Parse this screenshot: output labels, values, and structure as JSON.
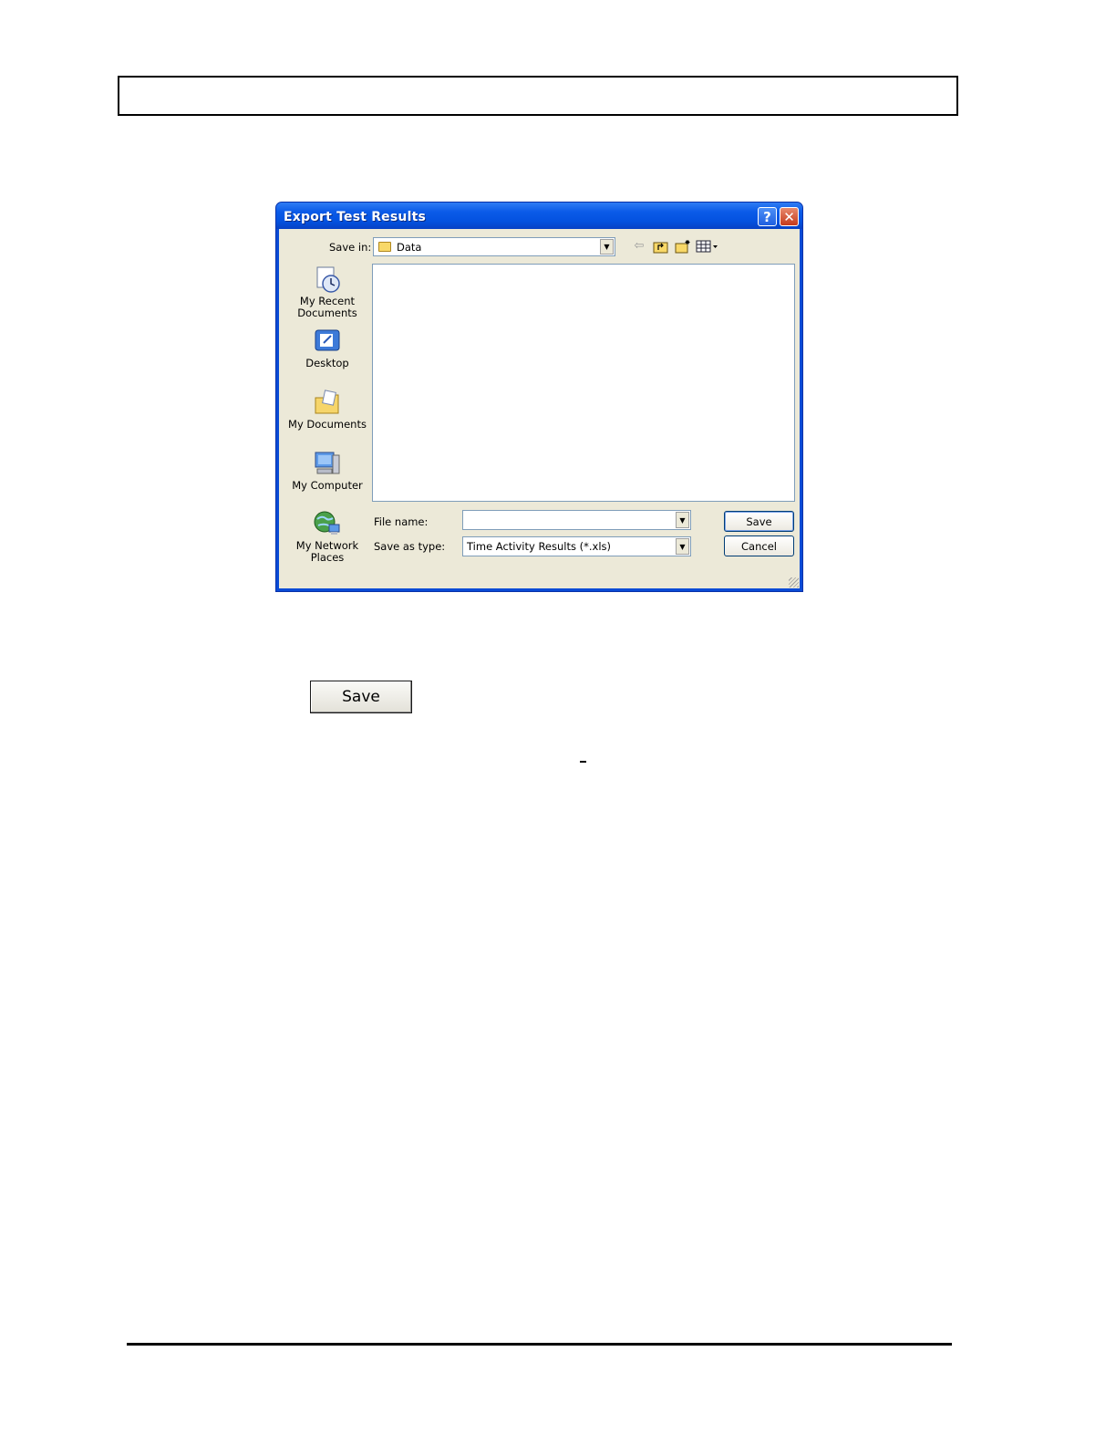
{
  "dialog": {
    "title": "Export Test  Results",
    "help_glyph": "?",
    "close_glyph": "✕",
    "save_in_label": "Save in:",
    "save_in_value": "Data",
    "places": [
      {
        "label": "My Recent Documents",
        "icon": "recent-documents-icon"
      },
      {
        "label": "Desktop",
        "icon": "desktop-icon"
      },
      {
        "label": "My Documents",
        "icon": "my-documents-icon"
      },
      {
        "label": "My Computer",
        "icon": "my-computer-icon"
      },
      {
        "label": "My Network Places",
        "icon": "network-places-icon"
      }
    ],
    "file_name_label": "File name:",
    "file_name_value": "",
    "save_as_type_label": "Save as type:",
    "save_as_type_value": "Time Activity Results (*.xls)",
    "save_button": "Save",
    "cancel_button": "Cancel",
    "toolbar_icons": [
      "back-arrow-icon",
      "up-folder-icon",
      "new-folder-icon",
      "views-menu-icon"
    ]
  },
  "standalone_button": {
    "label": "Save"
  }
}
